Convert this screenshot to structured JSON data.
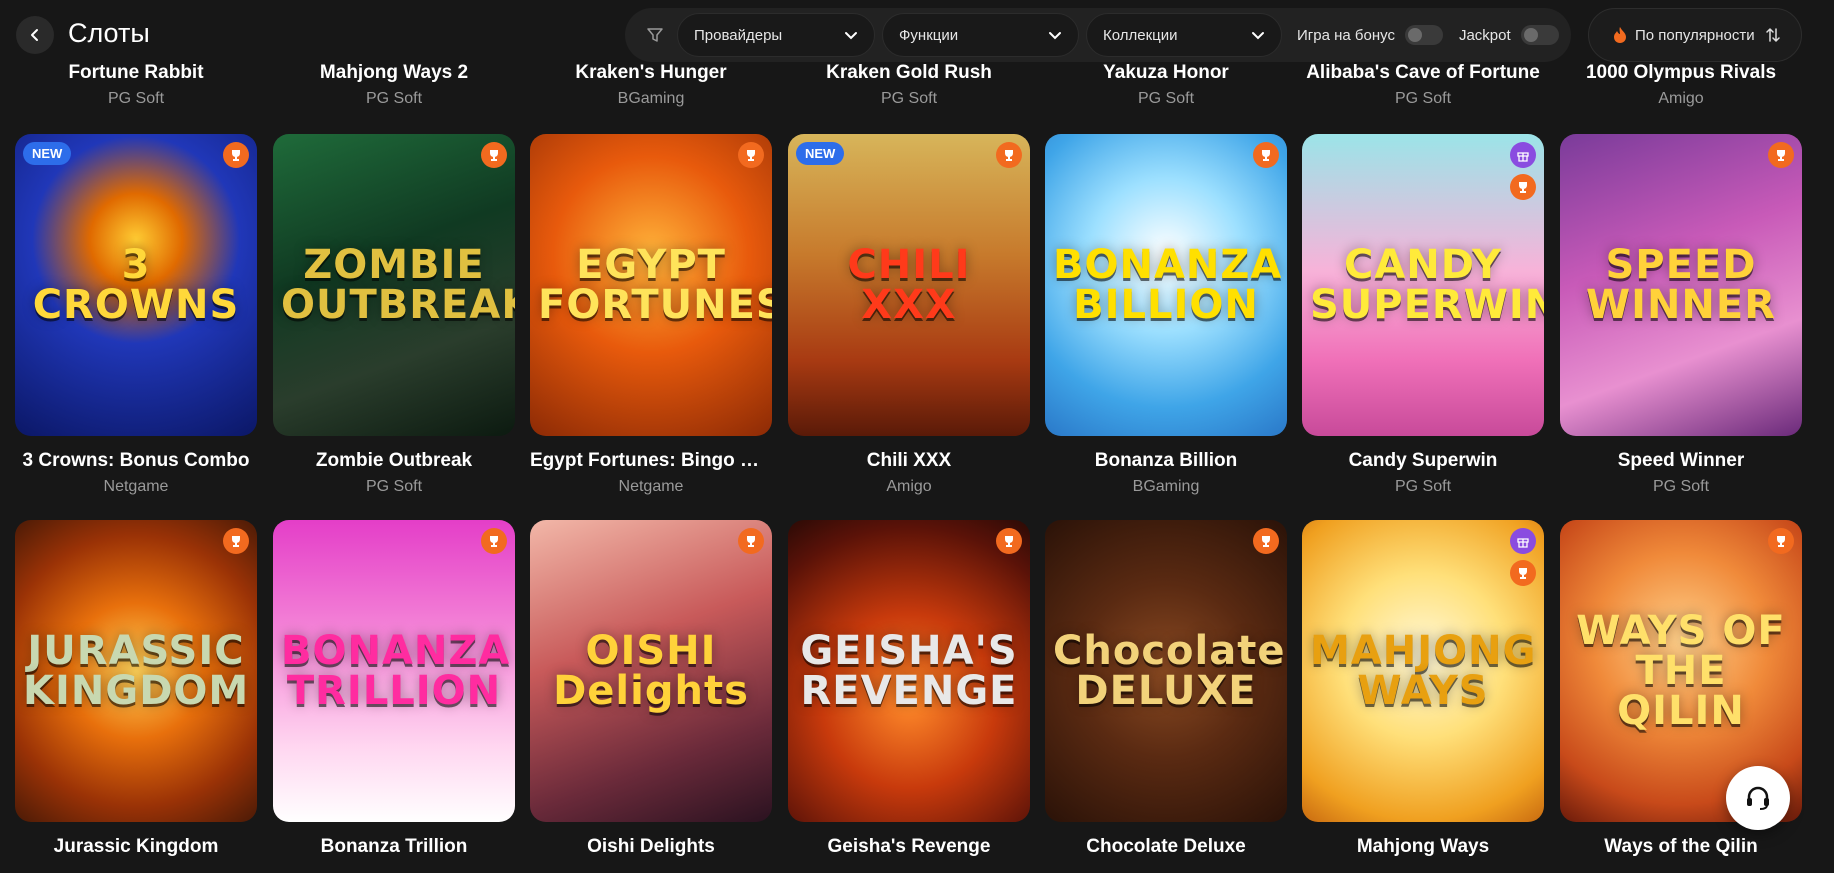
{
  "header": {
    "title": "Слоты",
    "filters": {
      "providers": "Провайдеры",
      "features": "Функции",
      "collections": "Коллекции",
      "bonus_toggle": "Игра на бонус",
      "jackpot_toggle": "Jackpot"
    },
    "sort": "По популярности"
  },
  "colors": {
    "accent_orange": "#f26a1f",
    "new_badge": "#2d6dea",
    "gift_badge": "#8a4ce0",
    "background": "#171717"
  },
  "top_row": [
    {
      "name": "Fortune Rabbit",
      "provider": "PG Soft"
    },
    {
      "name": "Mahjong Ways 2",
      "provider": "PG Soft"
    },
    {
      "name": "Kraken's Hunger",
      "provider": "BGaming"
    },
    {
      "name": "Kraken Gold Rush",
      "provider": "PG Soft"
    },
    {
      "name": "Yakuza Honor",
      "provider": "PG Soft"
    },
    {
      "name": "Alibaba's Cave of Fortune",
      "provider": "PG Soft"
    },
    {
      "name": "1000 Olympus Rivals",
      "provider": "Amigo"
    }
  ],
  "row2": [
    {
      "name": "3 Crowns: Bonus Combo",
      "provider": "Netgame",
      "art": "3 CROWNS",
      "badge_new": "NEW"
    },
    {
      "name": "Zombie Outbreak",
      "provider": "PG Soft",
      "art": "ZOMBIE OUTBREAK"
    },
    {
      "name": "Egypt Fortunes: Bingo Bo...",
      "provider": "Netgame",
      "art": "EGYPT FORTUNES"
    },
    {
      "name": "Chili XXX",
      "provider": "Amigo",
      "art": "CHILI XXX",
      "badge_new": "NEW"
    },
    {
      "name": "Bonanza Billion",
      "provider": "BGaming",
      "art": "BONANZA BILLION"
    },
    {
      "name": "Candy Superwin",
      "provider": "PG Soft",
      "art": "CANDY SUPERWIN"
    },
    {
      "name": "Speed Winner",
      "provider": "PG Soft",
      "art": "SPEED WINNER"
    }
  ],
  "row3": [
    {
      "name": "Jurassic Kingdom",
      "art": "JURASSIC KINGDOM"
    },
    {
      "name": "Bonanza Trillion",
      "art": "BONANZA TRILLION"
    },
    {
      "name": "Oishi Delights",
      "art": "OISHI Delights"
    },
    {
      "name": "Geisha's Revenge",
      "art": "GEISHA'S REVENGE"
    },
    {
      "name": "Chocolate Deluxe",
      "art": "Chocolate DELUXE"
    },
    {
      "name": "Mahjong Ways",
      "art": "MAHJONG WAYS"
    },
    {
      "name": "Ways of the Qilin",
      "art": "WAYS OF THE QILIN"
    }
  ],
  "icons": [
    "chevron-left-icon",
    "filter-icon",
    "chevron-down-icon",
    "fire-icon",
    "sort-icon",
    "trophy-icon",
    "gift-icon",
    "headset-icon"
  ]
}
